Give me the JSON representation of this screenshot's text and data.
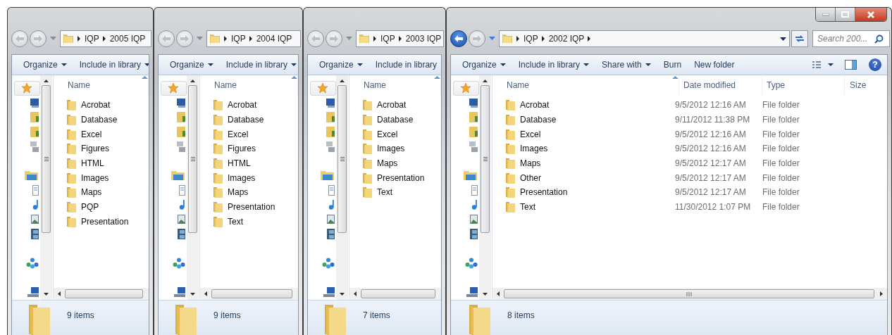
{
  "windows": [
    {
      "active": false,
      "breadcrumb": [
        "IQP",
        "2005 IQP"
      ],
      "toolbar": [
        {
          "label": "Organize",
          "menu": true
        },
        {
          "label": "Include in library",
          "menu": true
        }
      ],
      "columns": [
        "Name"
      ],
      "items": [
        {
          "name": "Acrobat"
        },
        {
          "name": "Database"
        },
        {
          "name": "Excel"
        },
        {
          "name": "Figures"
        },
        {
          "name": "HTML"
        },
        {
          "name": "Images"
        },
        {
          "name": "Maps"
        },
        {
          "name": "PQP"
        },
        {
          "name": "Presentation"
        }
      ],
      "status": "9 items"
    },
    {
      "active": false,
      "breadcrumb": [
        "IQP",
        "2004 IQP"
      ],
      "toolbar": [
        {
          "label": "Organize",
          "menu": true
        },
        {
          "label": "Include in library",
          "menu": true
        }
      ],
      "columns": [
        "Name"
      ],
      "items": [
        {
          "name": "Acrobat"
        },
        {
          "name": "Database"
        },
        {
          "name": "Excel"
        },
        {
          "name": "Figures"
        },
        {
          "name": "HTML"
        },
        {
          "name": "Images"
        },
        {
          "name": "Maps"
        },
        {
          "name": "Presentation"
        },
        {
          "name": "Text"
        }
      ],
      "status": "9 items"
    },
    {
      "active": false,
      "breadcrumb": [
        "IQP",
        "2003 IQP"
      ],
      "toolbar": [
        {
          "label": "Organize",
          "menu": true
        },
        {
          "label": "Include in library",
          "menu": false
        }
      ],
      "columns": [
        "Name"
      ],
      "items": [
        {
          "name": "Acrobat"
        },
        {
          "name": "Database"
        },
        {
          "name": "Excel"
        },
        {
          "name": "Images"
        },
        {
          "name": "Maps"
        },
        {
          "name": "Presentation"
        },
        {
          "name": "Text"
        }
      ],
      "status": "7 items"
    },
    {
      "active": true,
      "help": "?",
      "breadcrumb": [
        "IQP",
        "2002 IQP"
      ],
      "search": {
        "placeholder": "Search 200..."
      },
      "toolbar": [
        {
          "label": "Organize",
          "menu": true
        },
        {
          "label": "Include in library",
          "menu": true
        },
        {
          "label": "Share with",
          "menu": true
        },
        {
          "label": "Burn",
          "menu": false
        },
        {
          "label": "New folder",
          "menu": false
        }
      ],
      "columns": [
        "Name",
        "Date modified",
        "Type",
        "Size"
      ],
      "items": [
        {
          "name": "Acrobat",
          "date": "9/5/2012 12:16 AM",
          "type": "File folder"
        },
        {
          "name": "Database",
          "date": "9/11/2012 11:38 PM",
          "type": "File folder"
        },
        {
          "name": "Excel",
          "date": "9/5/2012 12:16 AM",
          "type": "File folder"
        },
        {
          "name": "Images",
          "date": "9/5/2012 12:16 AM",
          "type": "File folder"
        },
        {
          "name": "Maps",
          "date": "9/5/2012 12:17 AM",
          "type": "File folder"
        },
        {
          "name": "Other",
          "date": "9/5/2012 12:17 AM",
          "type": "File folder"
        },
        {
          "name": "Presentation",
          "date": "9/5/2012 12:17 AM",
          "type": "File folder"
        },
        {
          "name": "Text",
          "date": "11/30/2012 1:07 PM",
          "type": "File folder"
        }
      ],
      "status": "8 items"
    }
  ]
}
